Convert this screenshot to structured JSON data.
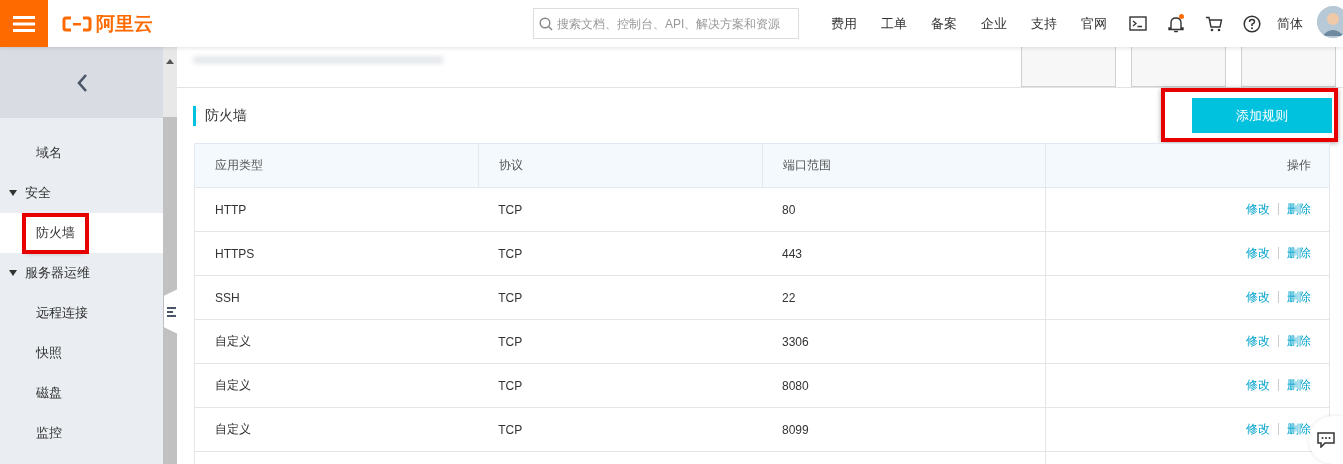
{
  "header": {
    "logo": "阿里云",
    "search": {
      "placeholder": "搜索文档、控制台、API、解决方案和资源"
    },
    "nav": [
      "费用",
      "工单",
      "备案",
      "企业",
      "支持",
      "官网"
    ],
    "notification_badge": true,
    "language": "简体"
  },
  "sidebar": {
    "items": [
      {
        "label": "域名",
        "selected": false,
        "highlighted": false
      },
      {
        "label": "安全",
        "expanded": true,
        "children": [
          {
            "label": "防火墙",
            "selected": true,
            "highlighted": true
          }
        ]
      },
      {
        "label": "服务器运维",
        "expanded": true,
        "children": [
          {
            "label": "远程连接",
            "selected": false,
            "highlighted": false
          },
          {
            "label": "快照",
            "selected": false,
            "highlighted": false
          },
          {
            "label": "磁盘",
            "selected": false,
            "highlighted": false
          },
          {
            "label": "监控",
            "selected": false,
            "highlighted": false
          }
        ]
      }
    ]
  },
  "panel": {
    "title": "防火墙",
    "add_button": {
      "label": "添加规则",
      "highlighted": true
    },
    "table": {
      "columns": [
        "应用类型",
        "协议",
        "端口范围",
        "操作"
      ],
      "rows": [
        {
          "cells": [
            "HTTP",
            "TCP",
            "80"
          ],
          "actions": [
            "修改",
            "删除"
          ]
        },
        {
          "cells": [
            "HTTPS",
            "TCP",
            "443"
          ],
          "actions": [
            "修改",
            "删除"
          ]
        },
        {
          "cells": [
            "SSH",
            "TCP",
            "22"
          ],
          "actions": [
            "修改",
            "删除"
          ]
        },
        {
          "cells": [
            "自定义",
            "TCP",
            "3306"
          ],
          "actions": [
            "修改",
            "删除"
          ]
        },
        {
          "cells": [
            "自定义",
            "TCP",
            "8080"
          ],
          "actions": [
            "修改",
            "删除"
          ]
        },
        {
          "cells": [
            "自定义",
            "TCP",
            "8099"
          ],
          "actions": [
            "修改",
            "删除"
          ]
        }
      ]
    }
  }
}
